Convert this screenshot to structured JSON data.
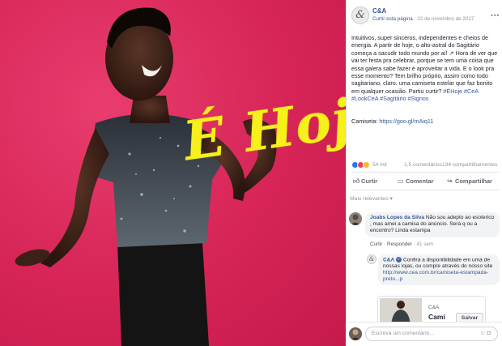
{
  "photo": {
    "overlay_text": "É Hoje",
    "background_color": "#d62456",
    "overlay_color": "#f7f01b"
  },
  "post": {
    "page_name": "C&A",
    "page_avatar_glyph": "&",
    "follow_label": "Curtir esta página",
    "date": "22 de novembro de 2017",
    "menu_icon": "more-horizontal-icon",
    "body": "Intuitivos, super sinceros, independentes e cheios de energia. A partir de hoje, o alto-astral do Sagitário começa a sacudir todo mundo por aí! ↗ Hora de ver que vai ter festa pra celebrar, porque se tem uma coisa que essa galera sabe fazer é aproveitar a vida. E o look pra esse momento? Tem brilho próprio, assim como todo sagitariano, claro. uma camiseta estelar que faz bonito em qualquer ocasião. Partiu curtir?",
    "hashtags": "#ÉHoje #CeA #LookCeA #Sagitário #Signos",
    "link_label": "Camiseta:",
    "link_url": "https://goo.gl/mAiq11",
    "reactions_count": "54 mil",
    "comments_count": "1,5 comentários",
    "shares_count": "134 compartilhamentos",
    "actions": {
      "like": "Curtir",
      "comment": "Comentar",
      "share": "Compartilhar"
    },
    "sort_label": "Mais relevantes ▾"
  },
  "comments": [
    {
      "author": "Joabs Lopes da Silva",
      "text": "Não sou adepto ao esoterico , mas amei a camisa do anúncio. Será q ou a encontro? Linda estampa",
      "like": "Curtir",
      "reply": "Responder",
      "time": "41 sem"
    }
  ],
  "reply": {
    "author": "C&A",
    "text": "Confira a disponibilidade em uma de nossas lojas, ou compre através do nosso site",
    "link": "http://www.cea.com.br/camiseta-estampada-preto...p"
  },
  "card": {
    "brand": "C&A",
    "title": "Cami",
    "save_label": "Salvar"
  },
  "composer": {
    "placeholder": "Escreva um comentário..."
  }
}
